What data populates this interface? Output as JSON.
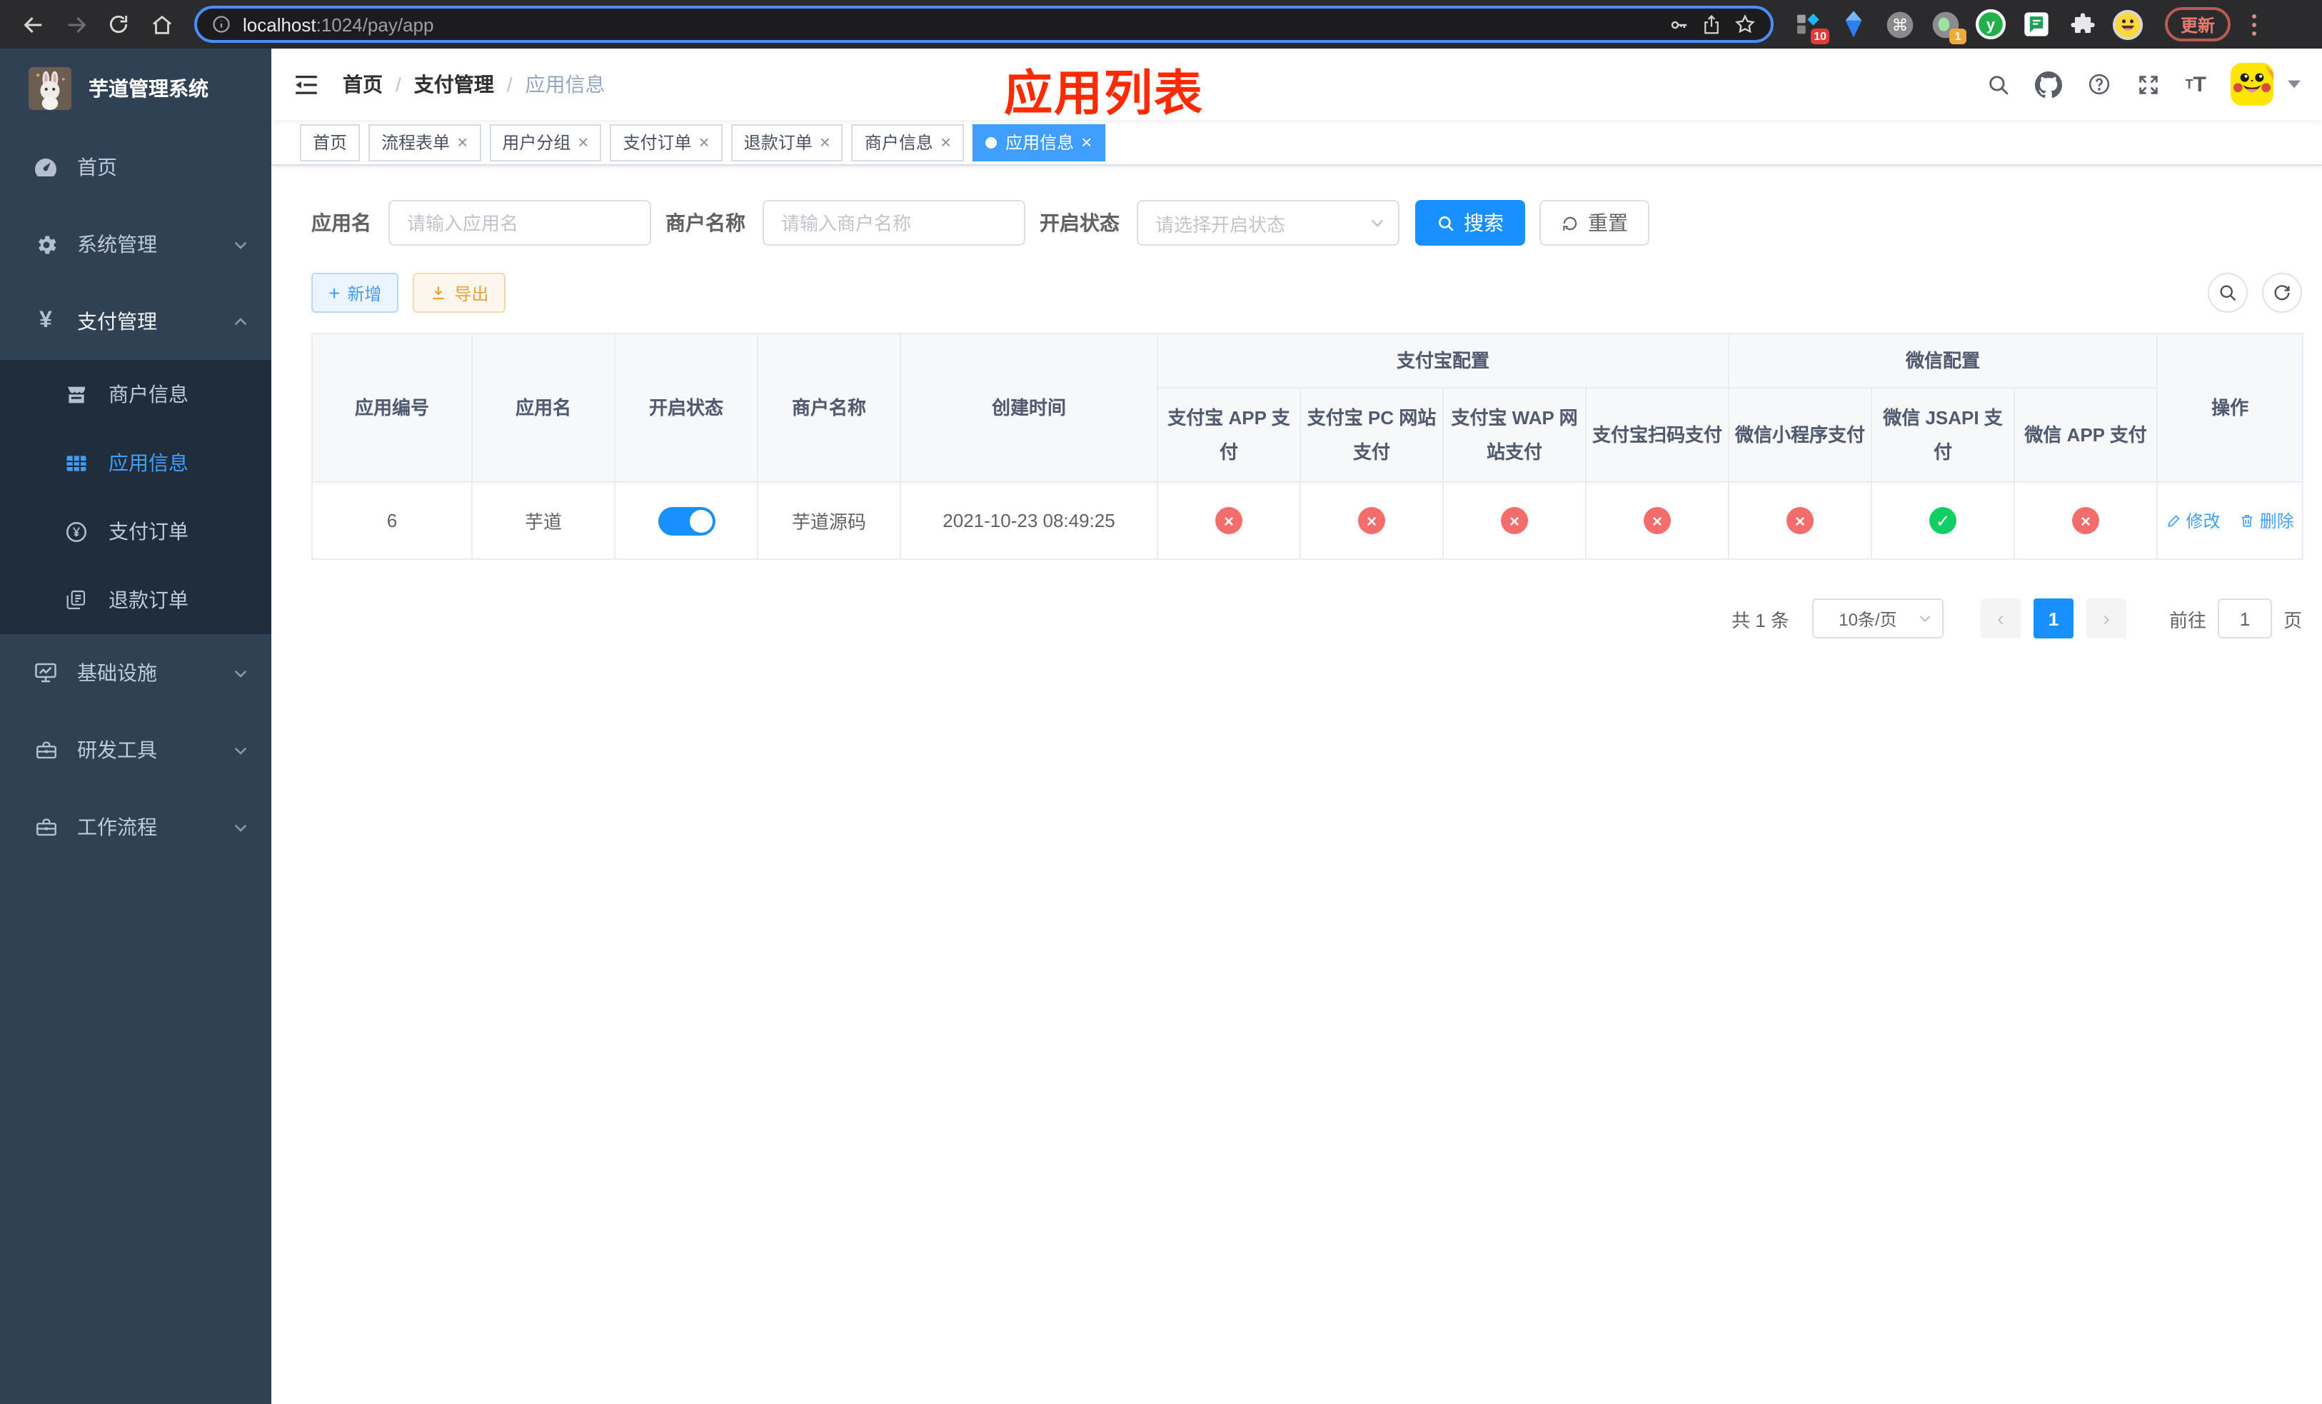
{
  "colors": {
    "accent": "#409eff",
    "primary": "#1890ff",
    "success": "#13ce66",
    "danger": "#f56c6c",
    "warning": "#e6a23c",
    "annotation": "#ff2a00",
    "sidebar": "#304156",
    "sidebar_submenu": "#1f2d3d"
  },
  "icons": {
    "close": "×",
    "plus": "+",
    "yen": "¥",
    "command": "⌘",
    "check": "✓",
    "cross": "×",
    "prev": "‹",
    "next": "›"
  },
  "browser": {
    "url_host": "localhost",
    "url_path": ":1024/pay/app",
    "update_label": "更新",
    "badge_ten": "10",
    "badge_one": "1"
  },
  "sidebar": {
    "title": "芋道管理系统",
    "home": "首页",
    "system": "系统管理",
    "payment": "支付管理",
    "merchant": "商户信息",
    "app_info": "应用信息",
    "pay_order": "支付订单",
    "refund_order": "退款订单",
    "infra": "基础设施",
    "dev_tools": "研发工具",
    "workflow": "工作流程"
  },
  "navbar": {
    "breadcrumb": [
      "首页",
      "支付管理",
      "应用信息"
    ],
    "separator": "/",
    "annotation": "应用列表"
  },
  "tabs": [
    {
      "label": "首页",
      "closable": false,
      "active": false
    },
    {
      "label": "流程表单",
      "closable": true,
      "active": false
    },
    {
      "label": "用户分组",
      "closable": true,
      "active": false
    },
    {
      "label": "支付订单",
      "closable": true,
      "active": false
    },
    {
      "label": "退款订单",
      "closable": true,
      "active": false
    },
    {
      "label": "商户信息",
      "closable": true,
      "active": false
    },
    {
      "label": "应用信息",
      "closable": true,
      "active": true
    }
  ],
  "filters": {
    "app_name_label": "应用名",
    "app_name_placeholder": "请输入应用名",
    "merchant_label": "商户名称",
    "merchant_placeholder": "请输入商户名称",
    "status_label": "开启状态",
    "status_placeholder": "请选择开启状态",
    "search_label": "搜索",
    "reset_label": "重置"
  },
  "toolbar": {
    "add_label": "新增",
    "export_label": "导出"
  },
  "table": {
    "headers": {
      "app_id": "应用编号",
      "app_name": "应用名",
      "status": "开启状态",
      "merchant": "商户名称",
      "create_time": "创建时间",
      "alipay_group": "支付宝配置",
      "wechat_group": "微信配置",
      "alipay_app": "支付宝 APP 支付",
      "alipay_pc": "支付宝 PC 网站支付",
      "alipay_wap": "支付宝 WAP 网站支付",
      "alipay_qr": "支付宝扫码支付",
      "wechat_lite": "微信小程序支付",
      "wechat_jsapi": "微信 JSAPI 支付",
      "wechat_app": "微信 APP 支付",
      "actions": "操作"
    },
    "row": {
      "app_id": "6",
      "app_name": "芋道",
      "status_on": true,
      "merchant": "芋道源码",
      "create_time": "2021-10-23 08:49:25",
      "configs": [
        "disabled",
        "disabled",
        "disabled",
        "disabled",
        "disabled",
        "enabled",
        "disabled"
      ],
      "edit_label": "修改",
      "delete_label": "删除"
    }
  },
  "pagination": {
    "total": "共 1 条",
    "page_size": "10条/页",
    "current_page": "1",
    "goto_label": "前往",
    "goto_value": "1",
    "page_unit": "页"
  }
}
